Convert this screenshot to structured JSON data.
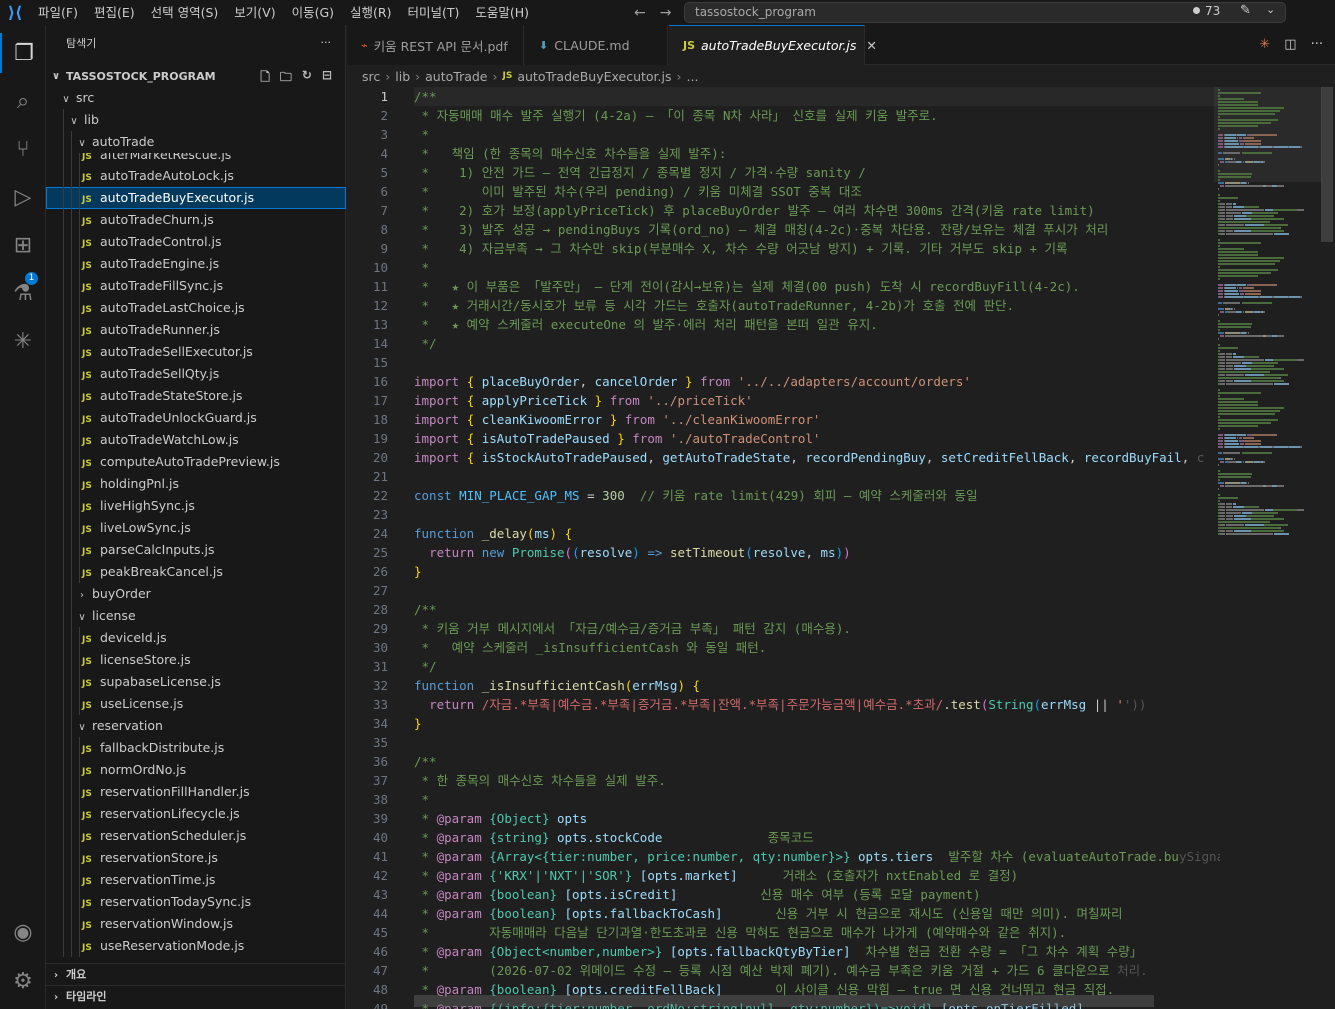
{
  "titlebar": {
    "menu": [
      "파일(F)",
      "편집(E)",
      "선택 영역(S)",
      "보기(V)",
      "이동(G)",
      "실행(R)",
      "터미널(T)",
      "도움말(H)"
    ],
    "search": "tassostock_program",
    "badge_count": "73"
  },
  "activity": {
    "icons": [
      "explorer-icon",
      "search-icon",
      "source-control-icon",
      "run-debug-icon",
      "extensions-icon",
      "testing-icon",
      "claude-icon",
      "account-icon",
      "gear-icon"
    ],
    "extensions_badge": "1"
  },
  "sidebar": {
    "title": "탐색기",
    "more": "···",
    "root": "TASSOSTOCK_PROGRAM",
    "tree": [
      {
        "label": "src",
        "depth": 0,
        "type": "folder",
        "open": true
      },
      {
        "label": "lib",
        "depth": 1,
        "type": "folder",
        "open": true
      },
      {
        "label": "autoTrade",
        "depth": 2,
        "type": "folder",
        "open": true
      },
      {
        "label": "afterMarketRescue.js",
        "depth": 3,
        "type": "file",
        "clipped": true
      },
      {
        "label": "autoTradeAutoLock.js",
        "depth": 3,
        "type": "file"
      },
      {
        "label": "autoTradeBuyExecutor.js",
        "depth": 3,
        "type": "file",
        "selected": true
      },
      {
        "label": "autoTradeChurn.js",
        "depth": 3,
        "type": "file"
      },
      {
        "label": "autoTradeControl.js",
        "depth": 3,
        "type": "file"
      },
      {
        "label": "autoTradeEngine.js",
        "depth": 3,
        "type": "file"
      },
      {
        "label": "autoTradeFillSync.js",
        "depth": 3,
        "type": "file"
      },
      {
        "label": "autoTradeLastChoice.js",
        "depth": 3,
        "type": "file"
      },
      {
        "label": "autoTradeRunner.js",
        "depth": 3,
        "type": "file"
      },
      {
        "label": "autoTradeSellExecutor.js",
        "depth": 3,
        "type": "file"
      },
      {
        "label": "autoTradeSellQty.js",
        "depth": 3,
        "type": "file"
      },
      {
        "label": "autoTradeStateStore.js",
        "depth": 3,
        "type": "file"
      },
      {
        "label": "autoTradeUnlockGuard.js",
        "depth": 3,
        "type": "file"
      },
      {
        "label": "autoTradeWatchLow.js",
        "depth": 3,
        "type": "file"
      },
      {
        "label": "computeAutoTradePreview.js",
        "depth": 3,
        "type": "file"
      },
      {
        "label": "holdingPnl.js",
        "depth": 3,
        "type": "file"
      },
      {
        "label": "liveHighSync.js",
        "depth": 3,
        "type": "file"
      },
      {
        "label": "liveLowSync.js",
        "depth": 3,
        "type": "file"
      },
      {
        "label": "parseCalcInputs.js",
        "depth": 3,
        "type": "file"
      },
      {
        "label": "peakBreakCancel.js",
        "depth": 3,
        "type": "file"
      },
      {
        "label": "buyOrder",
        "depth": 2,
        "type": "folder",
        "open": false
      },
      {
        "label": "license",
        "depth": 2,
        "type": "folder",
        "open": true
      },
      {
        "label": "deviceId.js",
        "depth": 3,
        "type": "file"
      },
      {
        "label": "licenseStore.js",
        "depth": 3,
        "type": "file"
      },
      {
        "label": "supabaseLicense.js",
        "depth": 3,
        "type": "file"
      },
      {
        "label": "useLicense.js",
        "depth": 3,
        "type": "file"
      },
      {
        "label": "reservation",
        "depth": 2,
        "type": "folder",
        "open": true
      },
      {
        "label": "fallbackDistribute.js",
        "depth": 3,
        "type": "file"
      },
      {
        "label": "normOrdNo.js",
        "depth": 3,
        "type": "file"
      },
      {
        "label": "reservationFillHandler.js",
        "depth": 3,
        "type": "file"
      },
      {
        "label": "reservationLifecycle.js",
        "depth": 3,
        "type": "file"
      },
      {
        "label": "reservationScheduler.js",
        "depth": 3,
        "type": "file"
      },
      {
        "label": "reservationStore.js",
        "depth": 3,
        "type": "file"
      },
      {
        "label": "reservationTime.js",
        "depth": 3,
        "type": "file"
      },
      {
        "label": "reservationTodaySync.js",
        "depth": 3,
        "type": "file"
      },
      {
        "label": "reservationWindow.js",
        "depth": 3,
        "type": "file"
      },
      {
        "label": "useReservationMode.js",
        "depth": 3,
        "type": "file"
      }
    ],
    "outline": "개요",
    "timeline": "타임라인"
  },
  "tabs": [
    {
      "label": "키움 REST API 문서.pdf",
      "icon": "pdf-icon",
      "glyph": "⌁",
      "color": "#e34c26"
    },
    {
      "label": "CLAUDE.md",
      "icon": "markdown-icon",
      "glyph": "⬇",
      "color": "#519aba"
    },
    {
      "label": "autoTradeBuyExecutor.js",
      "icon": "js-file-icon",
      "glyph": "JS",
      "color": "#cbcb41",
      "active": true
    }
  ],
  "breadcrumb": [
    "src",
    "lib",
    "autoTrade",
    "autoTradeBuyExecutor.js",
    "..."
  ],
  "editor": {
    "current_line": 1,
    "lines": [
      [
        [
          "c-com",
          "/**"
        ]
      ],
      [
        [
          "c-com",
          " * 자동매매 매수 발주 실행기 (4-2a) — 「이 종목 N차 사라」 신호를 실제 키움 발주로."
        ]
      ],
      [
        [
          "c-com",
          " *"
        ]
      ],
      [
        [
          "c-com",
          " *   책임 (한 종목의 매수신호 차수들을 실제 발주):"
        ]
      ],
      [
        [
          "c-com",
          " *    1) 안전 가드 — 전역 긴급정지 / 종목별 정지 / 가격·수량 sanity /"
        ]
      ],
      [
        [
          "c-com",
          " *       이미 발주된 차수(우리 pending) / 키움 미체결 SSOT 중복 대조"
        ]
      ],
      [
        [
          "c-com",
          " *    2) 호가 보정(applyPriceTick) 후 placeBuyOrder 발주 — 여러 차수면 300ms 간격(키움 rate limit)"
        ]
      ],
      [
        [
          "c-com",
          " *    3) 발주 성공 → pendingBuys 기록(ord_no) — 체결 매칭(4-2c)·중복 차단용. 잔량/보유는 체결 푸시가 처리"
        ]
      ],
      [
        [
          "c-com",
          " *    4) 자금부족 → 그 차수만 skip(부분매수 X, 차수 수량 어긋남 방지) + 기록. 기타 거부도 skip + 기록"
        ]
      ],
      [
        [
          "c-com",
          " *"
        ]
      ],
      [
        [
          "c-com",
          " *   ★ 이 부품은 「발주만」 — 단계 전이(감시→보유)는 실제 체결(00 push) 도착 시 recordBuyFill(4-2c)."
        ]
      ],
      [
        [
          "c-com",
          " *   ★ 거래시간/동시호가 보류 등 시각 가드는 호출자(autoTradeRunner, 4-2b)가 호출 전에 판단."
        ]
      ],
      [
        [
          "c-com",
          " *   ★ 예약 스케줄러 executeOne 의 발주·에러 처리 패턴을 본떠 일관 유지."
        ]
      ],
      [
        [
          "c-com",
          " */"
        ]
      ],
      [],
      [
        [
          "c-ctl",
          "import"
        ],
        [
          "c-txt",
          " "
        ],
        [
          "c-br1",
          "{"
        ],
        [
          "c-txt",
          " "
        ],
        [
          "c-var",
          "placeBuyOrder"
        ],
        [
          "c-txt",
          ", "
        ],
        [
          "c-var",
          "cancelOrder"
        ],
        [
          "c-txt",
          " "
        ],
        [
          "c-br1",
          "}"
        ],
        [
          "c-txt",
          " "
        ],
        [
          "c-ctl",
          "from"
        ],
        [
          "c-txt",
          " "
        ],
        [
          "c-str",
          "'../../adapters/account/orders'"
        ]
      ],
      [
        [
          "c-ctl",
          "import"
        ],
        [
          "c-txt",
          " "
        ],
        [
          "c-br1",
          "{"
        ],
        [
          "c-txt",
          " "
        ],
        [
          "c-var",
          "applyPriceTick"
        ],
        [
          "c-txt",
          " "
        ],
        [
          "c-br1",
          "}"
        ],
        [
          "c-txt",
          " "
        ],
        [
          "c-ctl",
          "from"
        ],
        [
          "c-txt",
          " "
        ],
        [
          "c-str",
          "'../priceTick'"
        ]
      ],
      [
        [
          "c-ctl",
          "import"
        ],
        [
          "c-txt",
          " "
        ],
        [
          "c-br1",
          "{"
        ],
        [
          "c-txt",
          " "
        ],
        [
          "c-var",
          "cleanKiwoomError"
        ],
        [
          "c-txt",
          " "
        ],
        [
          "c-br1",
          "}"
        ],
        [
          "c-txt",
          " "
        ],
        [
          "c-ctl",
          "from"
        ],
        [
          "c-txt",
          " "
        ],
        [
          "c-str",
          "'../cleanKiwoomError'"
        ]
      ],
      [
        [
          "c-ctl",
          "import"
        ],
        [
          "c-txt",
          " "
        ],
        [
          "c-br1",
          "{"
        ],
        [
          "c-txt",
          " "
        ],
        [
          "c-var",
          "isAutoTradePaused"
        ],
        [
          "c-txt",
          " "
        ],
        [
          "c-br1",
          "}"
        ],
        [
          "c-txt",
          " "
        ],
        [
          "c-ctl",
          "from"
        ],
        [
          "c-txt",
          " "
        ],
        [
          "c-str",
          "'./autoTradeControl'"
        ]
      ],
      [
        [
          "c-ctl",
          "import"
        ],
        [
          "c-txt",
          " "
        ],
        [
          "c-br1",
          "{"
        ],
        [
          "c-txt",
          " "
        ],
        [
          "c-var",
          "isStockAutoTradePaused"
        ],
        [
          "c-txt",
          ", "
        ],
        [
          "c-var",
          "getAutoTradeState"
        ],
        [
          "c-txt",
          ", "
        ],
        [
          "c-var",
          "recordPendingBuy"
        ],
        [
          "c-txt",
          ", "
        ],
        [
          "c-var",
          "setCreditFellBack"
        ],
        [
          "c-txt",
          ", "
        ],
        [
          "c-var",
          "recordBuyFail"
        ],
        [
          "c-txt",
          ", "
        ],
        [
          "c-fade",
          "c"
        ]
      ],
      [],
      [
        [
          "c-kw",
          "const"
        ],
        [
          "c-txt",
          " "
        ],
        [
          "c-const",
          "MIN_PLACE_GAP_MS"
        ],
        [
          "c-txt",
          " = "
        ],
        [
          "c-num",
          "300"
        ],
        [
          "c-txt",
          "  "
        ],
        [
          "c-com",
          "// 키움 rate limit(429) 회피 — 예약 스케줄러와 동일"
        ]
      ],
      [],
      [
        [
          "c-kw",
          "function"
        ],
        [
          "c-txt",
          " "
        ],
        [
          "c-fn",
          "_delay"
        ],
        [
          "c-br1",
          "("
        ],
        [
          "c-var",
          "ms"
        ],
        [
          "c-br1",
          ")"
        ],
        [
          "c-txt",
          " "
        ],
        [
          "c-br1",
          "{"
        ]
      ],
      [
        [
          "c-txt",
          "  "
        ],
        [
          "c-ctl",
          "return"
        ],
        [
          "c-txt",
          " "
        ],
        [
          "c-kw",
          "new"
        ],
        [
          "c-txt",
          " "
        ],
        [
          "c-cls",
          "Promise"
        ],
        [
          "c-br2",
          "("
        ],
        [
          "c-br3",
          "("
        ],
        [
          "c-var",
          "resolve"
        ],
        [
          "c-br3",
          ")"
        ],
        [
          "c-txt",
          " "
        ],
        [
          "c-kw",
          "=>"
        ],
        [
          "c-txt",
          " "
        ],
        [
          "c-fn",
          "setTimeout"
        ],
        [
          "c-br3",
          "("
        ],
        [
          "c-var",
          "resolve"
        ],
        [
          "c-txt",
          ", "
        ],
        [
          "c-var",
          "ms"
        ],
        [
          "c-br3",
          ")"
        ],
        [
          "c-br2",
          ")"
        ]
      ],
      [
        [
          "c-br1",
          "}"
        ]
      ],
      [],
      [
        [
          "c-com",
          "/**"
        ]
      ],
      [
        [
          "c-com",
          " * 키움 거부 메시지에서 「자금/예수금/증거금 부족」 패턴 감지 (매수용)."
        ]
      ],
      [
        [
          "c-com",
          " *   예약 스케줄러 _isInsufficientCash 와 동일 패턴."
        ]
      ],
      [
        [
          "c-com",
          " */"
        ]
      ],
      [
        [
          "c-kw",
          "function"
        ],
        [
          "c-txt",
          " "
        ],
        [
          "c-fn",
          "_isInsufficientCash"
        ],
        [
          "c-br1",
          "("
        ],
        [
          "c-var",
          "errMsg"
        ],
        [
          "c-br1",
          ")"
        ],
        [
          "c-txt",
          " "
        ],
        [
          "c-br1",
          "{"
        ]
      ],
      [
        [
          "c-txt",
          "  "
        ],
        [
          "c-ctl",
          "return"
        ],
        [
          "c-txt",
          " "
        ],
        [
          "c-re",
          "/자금.*부족|예수금.*부족|증거금.*부족|잔액.*부족|주문가능금액|예수금.*초과/"
        ],
        [
          "c-txt",
          "."
        ],
        [
          "c-fn",
          "test"
        ],
        [
          "c-br2",
          "("
        ],
        [
          "c-cls",
          "String"
        ],
        [
          "c-br3",
          "("
        ],
        [
          "c-var",
          "errMsg"
        ],
        [
          "c-txt",
          " || "
        ],
        [
          "c-str",
          "'"
        ],
        [
          "c-fade",
          "'))"
        ]
      ],
      [
        [
          "c-br1",
          "}"
        ]
      ],
      [],
      [
        [
          "c-com",
          "/**"
        ]
      ],
      [
        [
          "c-com",
          " * 한 종목의 매수신호 차수들을 실제 발주."
        ]
      ],
      [
        [
          "c-com",
          " *"
        ]
      ],
      [
        [
          "c-com",
          " * "
        ],
        [
          "c-tag",
          "@param"
        ],
        [
          "c-com",
          " "
        ],
        [
          "c-type",
          "{Object}"
        ],
        [
          "c-com",
          " "
        ],
        [
          "c-var",
          "opts"
        ]
      ],
      [
        [
          "c-com",
          " * "
        ],
        [
          "c-tag",
          "@param"
        ],
        [
          "c-com",
          " "
        ],
        [
          "c-type",
          "{string}"
        ],
        [
          "c-com",
          " "
        ],
        [
          "c-var",
          "opts.stockCode"
        ],
        [
          "c-com",
          "              종목코드"
        ]
      ],
      [
        [
          "c-com",
          " * "
        ],
        [
          "c-tag",
          "@param"
        ],
        [
          "c-com",
          " "
        ],
        [
          "c-type",
          "{Array<{tier:number, price:number, qty:number}>}"
        ],
        [
          "c-com",
          " "
        ],
        [
          "c-var",
          "opts.tiers"
        ],
        [
          "c-com",
          "  발주할 차수 (evaluateAutoTrade.bu"
        ],
        [
          "c-fade",
          "ySignals)"
        ]
      ],
      [
        [
          "c-com",
          " * "
        ],
        [
          "c-tag",
          "@param"
        ],
        [
          "c-com",
          " "
        ],
        [
          "c-type",
          "{'KRX'|'NXT'|'SOR'}"
        ],
        [
          "c-com",
          " "
        ],
        [
          "c-var",
          "[opts.market]"
        ],
        [
          "c-com",
          "      거래소 (호출자가 nxtEnabled 로 결정)"
        ]
      ],
      [
        [
          "c-com",
          " * "
        ],
        [
          "c-tag",
          "@param"
        ],
        [
          "c-com",
          " "
        ],
        [
          "c-type",
          "{boolean}"
        ],
        [
          "c-com",
          " "
        ],
        [
          "c-var",
          "[opts.isCredit]"
        ],
        [
          "c-com",
          "           신용 매수 여부 (등록 모달 payment)"
        ]
      ],
      [
        [
          "c-com",
          " * "
        ],
        [
          "c-tag",
          "@param"
        ],
        [
          "c-com",
          " "
        ],
        [
          "c-type",
          "{boolean}"
        ],
        [
          "c-com",
          " "
        ],
        [
          "c-var",
          "[opts.fallbackToCash]"
        ],
        [
          "c-com",
          "       신용 거부 시 현금으로 재시도 (신용일 때만 의미). 며칠짜리"
        ]
      ],
      [
        [
          "c-com",
          " *        자동매매라 다음날 단기과열·한도초과로 신용 막혀도 현금으로 매수가 나가게 (예약매수와 같은 취지)."
        ]
      ],
      [
        [
          "c-com",
          " * "
        ],
        [
          "c-tag",
          "@param"
        ],
        [
          "c-com",
          " "
        ],
        [
          "c-type",
          "{Object<number,number>}"
        ],
        [
          "c-com",
          " "
        ],
        [
          "c-var",
          "[opts.fallbackQtyByTier]"
        ],
        [
          "c-com",
          "  차수별 현금 전환 수량 = 「그 차수 계획 수량」"
        ]
      ],
      [
        [
          "c-com",
          " *        (2026-07-02 위메이드 수정 — 등록 시점 예산 박제 폐기). 예수금 부족은 키움 거절 + 가드 6 클다운으로 "
        ],
        [
          "c-fade",
          "처리."
        ]
      ],
      [
        [
          "c-com",
          " * "
        ],
        [
          "c-tag",
          "@param"
        ],
        [
          "c-com",
          " "
        ],
        [
          "c-type",
          "{boolean}"
        ],
        [
          "c-com",
          " "
        ],
        [
          "c-var",
          "[opts.creditFellBack]"
        ],
        [
          "c-com",
          "       이 사이클 신용 막힘 — true 면 신용 건너뛰고 현금 직접."
        ]
      ],
      [
        [
          "c-com",
          " * "
        ],
        [
          "c-tag",
          "@param"
        ],
        [
          "c-com",
          " "
        ],
        [
          "c-type",
          "{(info:{tier:number, ordNo:string|null, qty:number})=>void}"
        ],
        [
          "c-com",
          " "
        ],
        [
          "c-var",
          "[opts.onTierFilled]"
        ]
      ]
    ]
  }
}
